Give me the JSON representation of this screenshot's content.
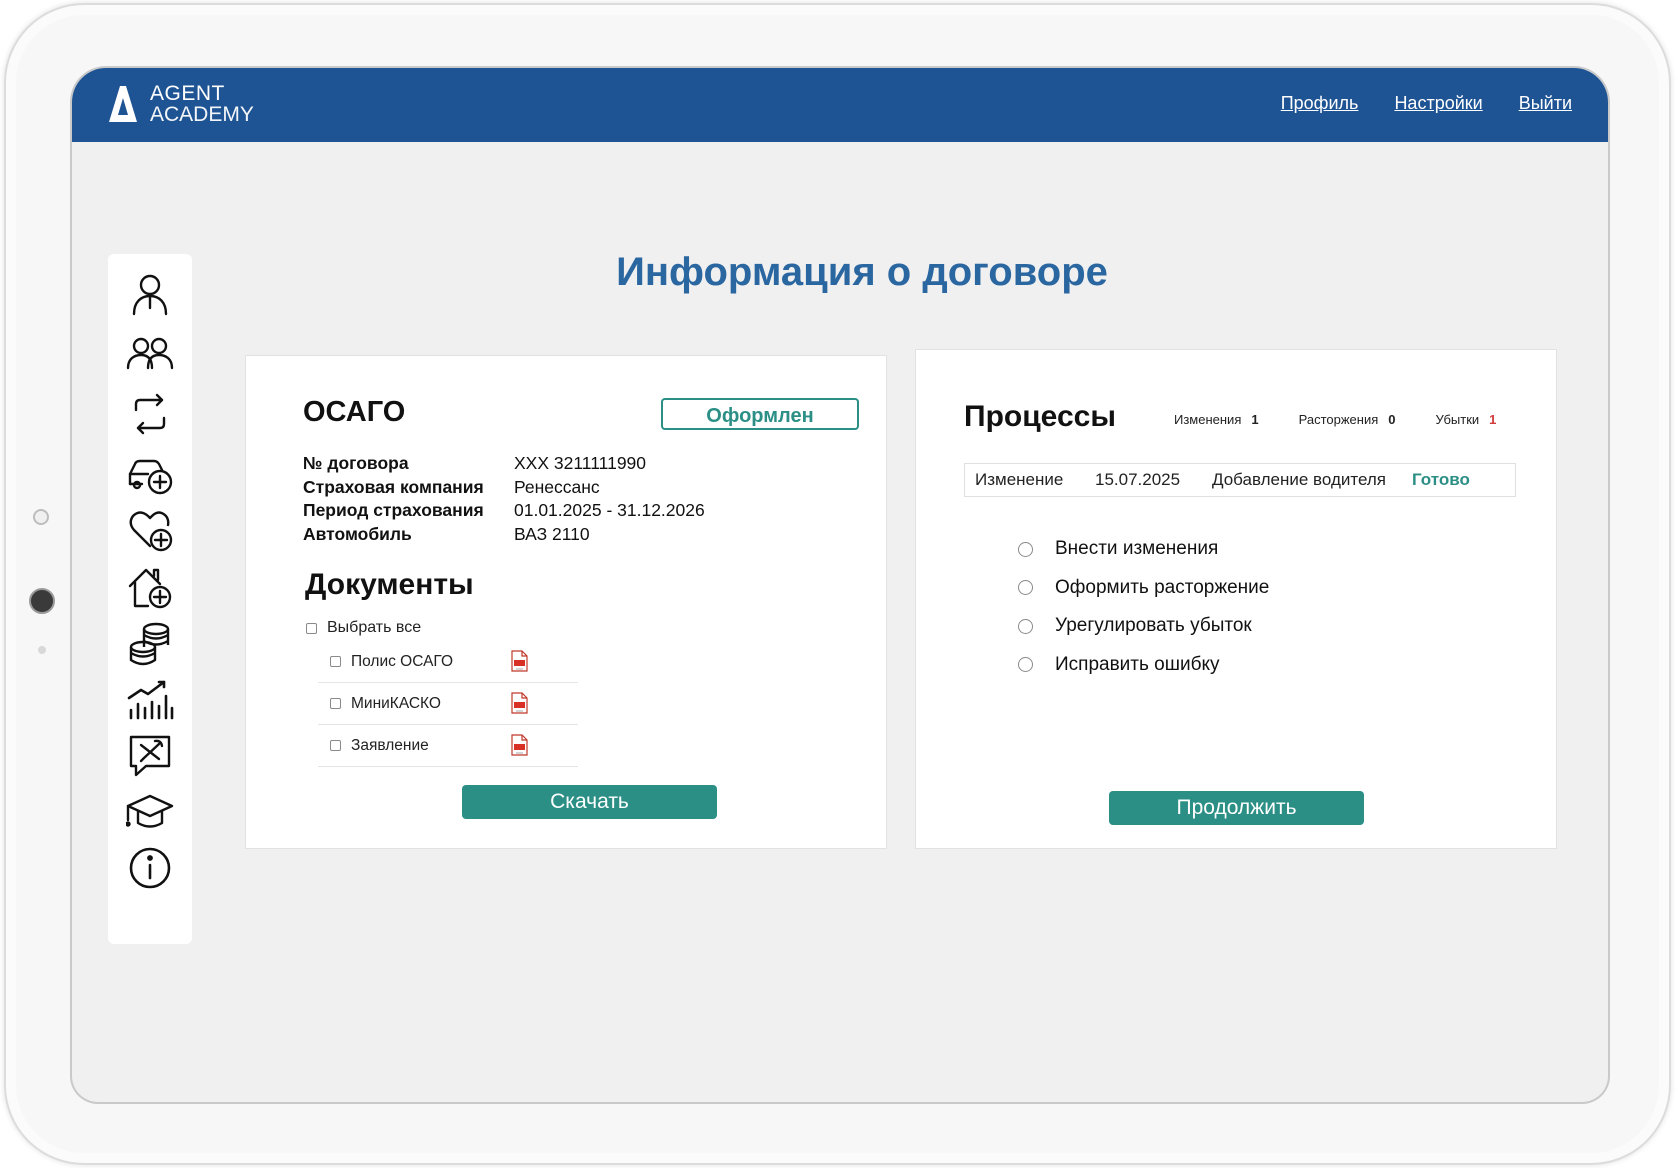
{
  "header": {
    "logo_line1": "AGENT",
    "logo_line2": "ACADEMY",
    "nav": {
      "profile": "Профиль",
      "settings": "Настройки",
      "logout": "Выйти"
    }
  },
  "sidebar": {
    "icons": [
      "person-icon",
      "people-icon",
      "sync-icon",
      "car-add-icon",
      "heart-add-icon",
      "home-add-icon",
      "coins-icon",
      "chart-icon",
      "tools-chat-icon",
      "graduation-cap-icon",
      "info-icon"
    ]
  },
  "page": {
    "title": "Информация о договоре"
  },
  "contract": {
    "product": "ОСАГО",
    "status": "Оформлен",
    "fields": [
      {
        "label": "№ договора",
        "value": "XXX 3211111990"
      },
      {
        "label": "Страховая компания",
        "value": "Ренессанс"
      },
      {
        "label": "Период страхования",
        "value": "01.01.2025 - 31.12.2026"
      },
      {
        "label": "Автомобиль",
        "value": "ВАЗ 2110"
      }
    ]
  },
  "documents": {
    "title": "Документы",
    "select_all": "Выбрать все",
    "items": [
      "Полис ОСАГО",
      "МиниКАСКО",
      "Заявление"
    ],
    "download_label": "Скачать"
  },
  "processes": {
    "title": "Процессы",
    "counters": [
      {
        "label": "Изменения",
        "count": "1"
      },
      {
        "label": "Расторжения",
        "count": "0"
      },
      {
        "label": "Убытки",
        "count": "1"
      }
    ],
    "row": {
      "type": "Изменение",
      "date": "15.07.2025",
      "description": "Добавление водителя",
      "status": "Готово"
    },
    "options": [
      "Внести изменения",
      "Оформить расторжение",
      "Урегулировать убыток",
      "Исправить ошибку"
    ],
    "continue_label": "Продолжить"
  },
  "colors": {
    "header": "#1f5494",
    "accent": "#2b8f86",
    "title": "#2a66a0",
    "alert": "#d23a3a"
  }
}
